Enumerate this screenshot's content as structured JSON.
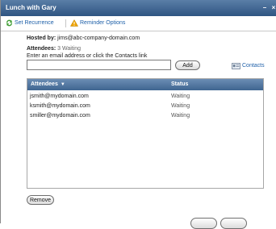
{
  "window": {
    "title": "Lunch with Gary",
    "minimize_glyph": "–",
    "close_glyph": "×"
  },
  "toolbar": {
    "recurrence_label": "Set Recurrence",
    "recurrence_icon": "recurrence-arrows-icon",
    "reminder_label": "Reminder Options",
    "reminder_icon": "warning-triangle-icon",
    "icon_colors": {
      "recurrence": "#3b9b2f",
      "reminder": "#f0a400"
    }
  },
  "meeting": {
    "hosted_label": "Hosted by:",
    "host": "jims@abc-company-domain.com",
    "attendees_label": "Attendees:",
    "attendees_status": "3 Waiting",
    "instruction": "Enter an email address or click the Contacts link"
  },
  "email_input": {
    "value": "",
    "placeholder": ""
  },
  "buttons": {
    "add": "Add",
    "remove": "Remove",
    "bottom_left": "",
    "bottom_right": ""
  },
  "contacts": {
    "label": "Contacts",
    "icon": "address-card-icon"
  },
  "table": {
    "col_attendees": "Attendees",
    "col_status": "Status",
    "sort_glyph": "▼",
    "header_color": "#4a6f9a",
    "rows": [
      {
        "email": "jsmith@mydomain.com",
        "status": "Waiting"
      },
      {
        "email": "ksmith@mydomain.com",
        "status": "Waiting"
      },
      {
        "email": "smiller@mydomain.com",
        "status": "Waiting"
      }
    ]
  }
}
